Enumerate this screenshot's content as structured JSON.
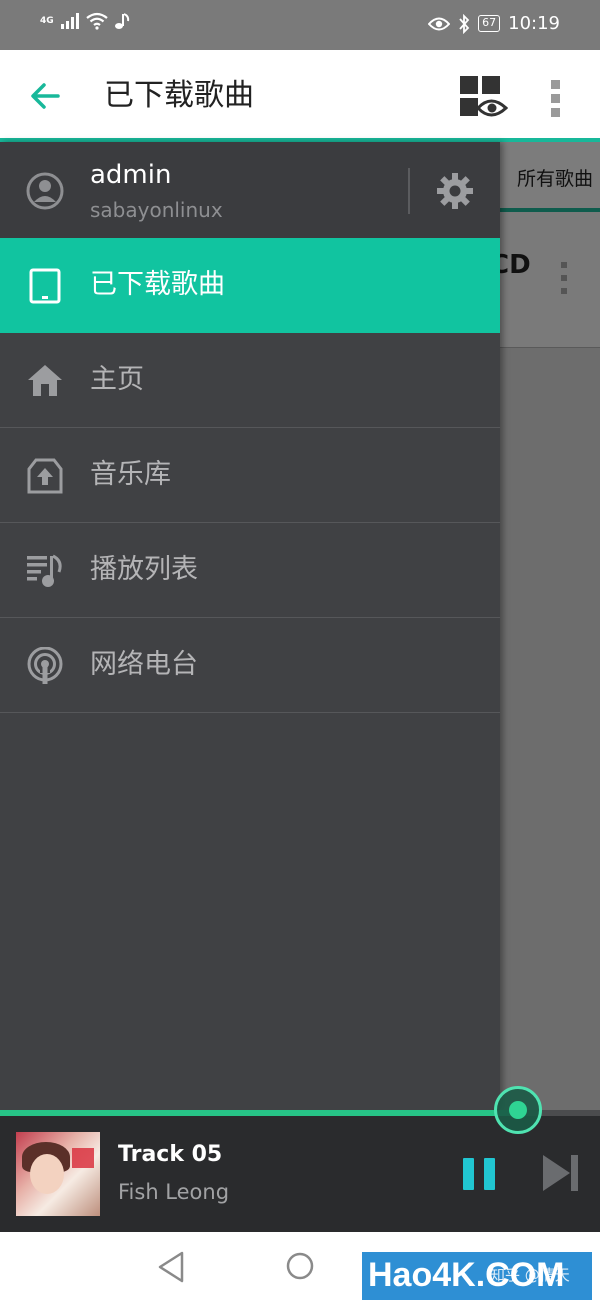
{
  "status_bar": {
    "network": "4G",
    "battery": "67",
    "time": "10:19"
  },
  "app_bar": {
    "title": "已下载歌曲"
  },
  "background": {
    "tab_label": "所有歌曲",
    "row_text": "CD"
  },
  "drawer": {
    "account": {
      "username": "admin",
      "server": "sabayonlinux"
    },
    "items": [
      {
        "label": "已下载歌曲",
        "icon": "tablet-icon",
        "active": true
      },
      {
        "label": "主页",
        "icon": "home-icon",
        "active": false
      },
      {
        "label": "音乐库",
        "icon": "library-icon",
        "active": false
      },
      {
        "label": "播放列表",
        "icon": "playlist-icon",
        "active": false
      },
      {
        "label": "网络电台",
        "icon": "radio-icon",
        "active": false
      }
    ]
  },
  "player": {
    "track": "Track 05",
    "artist": "Fish Leong",
    "progress": 0.86
  },
  "colors": {
    "accent": "#11c4a0",
    "drawer_bg": "#404144",
    "player_bg": "#2a2b2d",
    "progress": "#27c487"
  },
  "watermark": {
    "brand": "Hao4K.COM",
    "sub": "知乎 @情天"
  }
}
